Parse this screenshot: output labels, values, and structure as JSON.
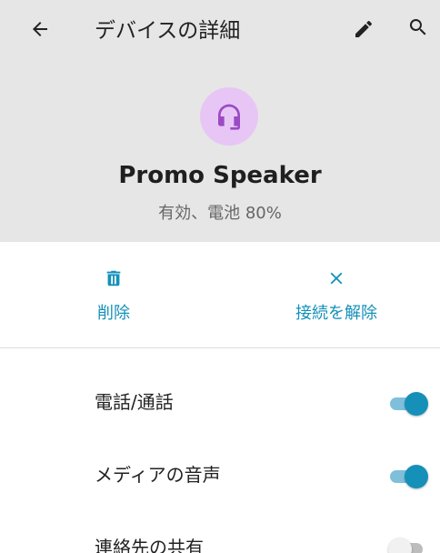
{
  "appbar": {
    "title": "デバイスの詳細",
    "icons": {
      "back": "arrow-back-icon",
      "edit": "pencil-icon",
      "search": "search-icon"
    }
  },
  "device": {
    "name": "Promo Speaker",
    "status": "有効、電池 80%",
    "icon": "headset-icon",
    "icon_bg": "#e7c6f6",
    "icon_color": "#9b4bc4"
  },
  "actions": {
    "delete_label": "削除",
    "disconnect_label": "接続を解除",
    "accent": "#1590b9"
  },
  "settings": [
    {
      "label": "電話/通話",
      "enabled": true
    },
    {
      "label": "メディアの音声",
      "enabled": true
    },
    {
      "label": "連絡先の共有",
      "enabled": false
    }
  ]
}
